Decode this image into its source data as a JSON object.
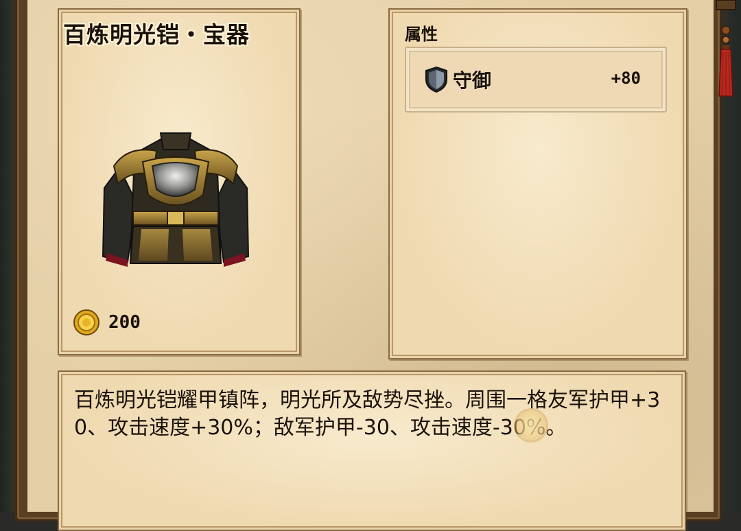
{
  "item": {
    "title": "百炼明光铠・宝器",
    "price": "200",
    "icon": "armor-icon",
    "currency_icon": "gold-coin-icon"
  },
  "attributes": {
    "heading": "属性",
    "rows": [
      {
        "icon": "shield-icon",
        "name": "守御",
        "value": "+80"
      }
    ]
  },
  "description": {
    "text": "百炼明光铠耀甲镇阵，明光所及敌势尽挫。周围一格友军护甲+30、攻击速度+30%；敌军护甲-30、攻击速度-30%。"
  },
  "colors": {
    "parchment": "#e4cfa6",
    "panel": "#efd9b0",
    "border": "#8a6a44",
    "text": "#1a120a",
    "tassel_red": "#b8281e"
  }
}
